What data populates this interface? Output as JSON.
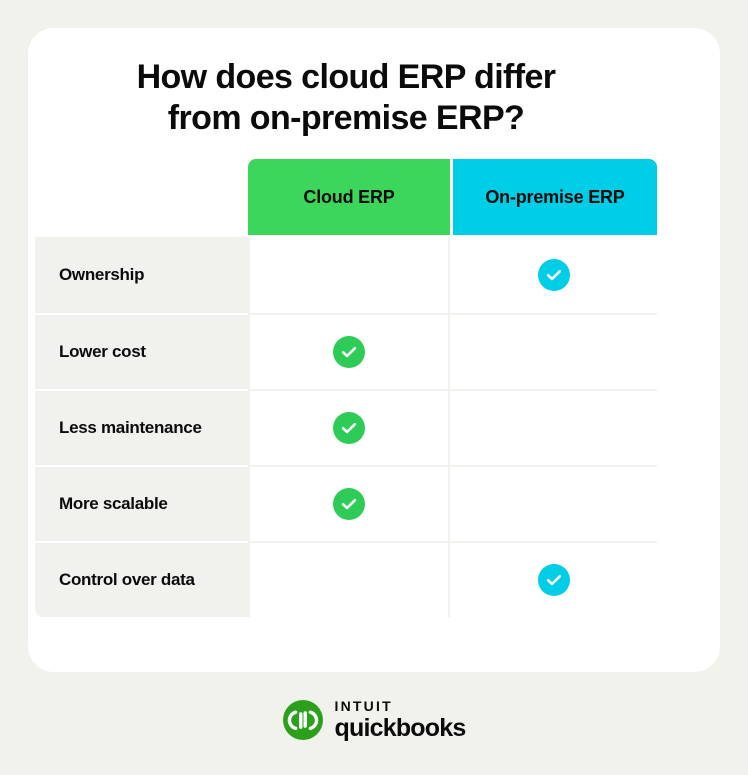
{
  "page": {
    "background_color": "#F1F2EC",
    "card_background_color": "#FFFFFF"
  },
  "heading": {
    "line1": "How does cloud ERP differ",
    "line2": "from on-premise ERP?",
    "full_text": "How does cloud ERP differ from on-premise ERP?"
  },
  "table": {
    "columns": [
      {
        "id": "feature",
        "label": "",
        "header_color": null
      },
      {
        "id": "cloud",
        "label": "Cloud ERP",
        "header_color": "#3CD65C",
        "check_color": "#2ECC56"
      },
      {
        "id": "onprem",
        "label": "On-premise ERP",
        "header_color": "#00CDE6",
        "check_color": "#00CDE6"
      }
    ],
    "rows": [
      {
        "label": "Ownership",
        "cloud": false,
        "onprem": true
      },
      {
        "label": "Lower cost",
        "cloud": true,
        "onprem": false
      },
      {
        "label": "Less maintenance",
        "cloud": true,
        "onprem": false
      },
      {
        "label": "More scalable",
        "cloud": true,
        "onprem": false
      },
      {
        "label": "Control over data",
        "cloud": false,
        "onprem": true
      }
    ],
    "check_icon_name": "check-circle-icon",
    "label_cell_color": "#F1F2ED",
    "grid_line_color": "#F1F2ED"
  },
  "logo": {
    "mark_text": "qb",
    "mark_color": "#2CA01C",
    "brand_top": "intuit",
    "brand_bottom": "quickbooks"
  },
  "chart_data": {
    "type": "table",
    "title": "How does cloud ERP differ from on-premise ERP?",
    "categories": [
      "Ownership",
      "Lower cost",
      "Less maintenance",
      "More scalable",
      "Control over data"
    ],
    "series": [
      {
        "name": "Cloud ERP",
        "values": [
          0,
          1,
          1,
          1,
          0
        ]
      },
      {
        "name": "On-premise ERP",
        "values": [
          1,
          0,
          0,
          0,
          1
        ]
      }
    ],
    "value_meaning": {
      "1": "checkmark present",
      "0": "empty cell"
    },
    "xlabel": "",
    "ylabel": "",
    "legend": [
      "Cloud ERP",
      "On-premise ERP"
    ]
  }
}
